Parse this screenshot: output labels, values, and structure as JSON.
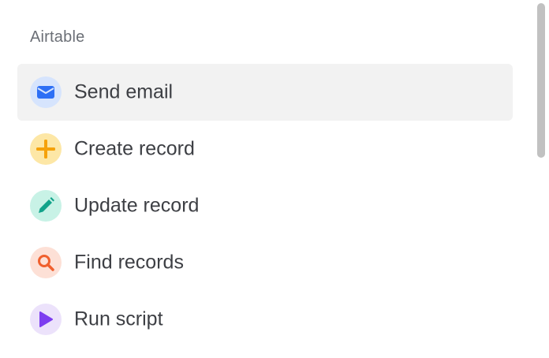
{
  "section": {
    "heading": "Airtable"
  },
  "actions": [
    {
      "label": "Send email",
      "icon": "envelope-icon",
      "bg": "#d6e4fd",
      "fg": "#2d6ff5",
      "selected": true
    },
    {
      "label": "Create record",
      "icon": "plus-icon",
      "bg": "#fde7a6",
      "fg": "#f5a20b",
      "selected": false
    },
    {
      "label": "Update record",
      "icon": "pencil-icon",
      "bg": "#c8f2e6",
      "fg": "#12a38a",
      "selected": false
    },
    {
      "label": "Find records",
      "icon": "search-icon",
      "bg": "#fde0d6",
      "fg": "#f0602e",
      "selected": false
    },
    {
      "label": "Run script",
      "icon": "play-icon",
      "bg": "#ece2fb",
      "fg": "#7d3df0",
      "selected": false
    }
  ],
  "colors": {
    "selected_row": "#f2f2f2",
    "label_text": "#3d3f44",
    "heading_text": "#6b6f76",
    "scrollbar_thumb": "#c1c1c1"
  }
}
